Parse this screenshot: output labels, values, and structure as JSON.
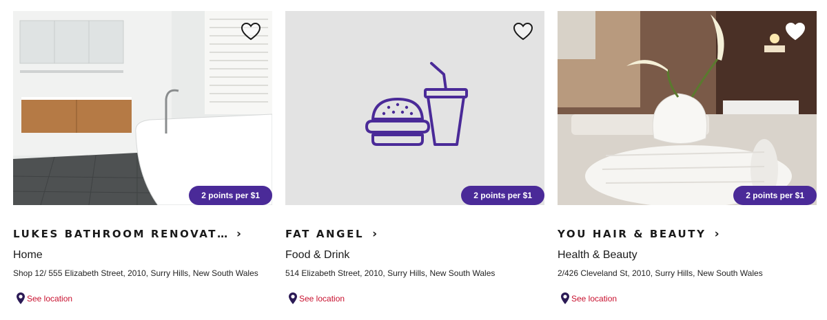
{
  "theme": {
    "accent": "#4a2a98",
    "link": "#c8102e",
    "text": "#1a1a1a"
  },
  "cards": [
    {
      "image": "bathroom-photo",
      "badge": "2 points per $1",
      "title": "LUKES BATHROOM RENOVATIO…",
      "category": "Home",
      "address": "Shop 12/ 555 Elizabeth Street, 2010, Surry Hills, New South Wales",
      "location_label": "See location",
      "favorite_icon": "heart-icon"
    },
    {
      "image": "burger-drink-illustration",
      "badge": "2 points per $1",
      "title": "FAT ANGEL",
      "category": "Food & Drink",
      "address": "514 Elizabeth Street, 2010, Surry Hills, New South Wales",
      "location_label": "See location",
      "favorite_icon": "heart-icon"
    },
    {
      "image": "towels-lily-photo",
      "badge": "2 points per $1",
      "title": "YOU HAIR & BEAUTY",
      "category": "Health & Beauty",
      "address": "2/426 Cleveland St, 2010, Surry Hills, New South Wales",
      "location_label": "See location",
      "favorite_icon": "heart-icon"
    }
  ]
}
